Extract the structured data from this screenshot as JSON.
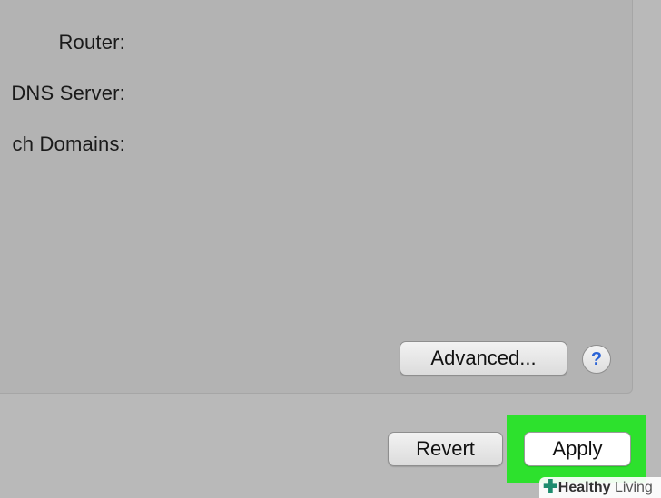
{
  "form": {
    "router_label": "Router:",
    "dns_label": "DNS Server:",
    "search_domains_label": "ch Domains:"
  },
  "buttons": {
    "advanced": "Advanced...",
    "help": "?",
    "revert": "Revert",
    "apply": "Apply"
  },
  "watermark": {
    "brand_bold": "Healthy",
    "brand_light": "Living"
  },
  "colors": {
    "highlight": "#2de12d",
    "help_accent": "#2a63d6",
    "watermark_plus": "#1e8c6e"
  }
}
